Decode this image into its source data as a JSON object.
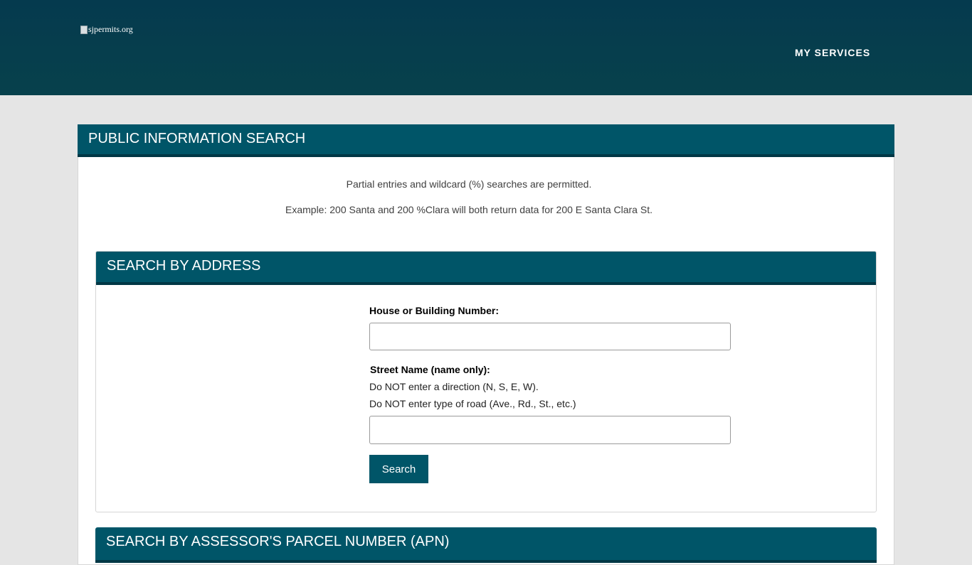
{
  "header": {
    "logo_alt": "sjpermits.org",
    "nav": [
      {
        "label": "MY SERVICES"
      }
    ]
  },
  "public_search": {
    "title": "PUBLIC INFORMATION SEARCH",
    "info": [
      "Partial entries and wildcard (%) searches are permitted.",
      "Example: 200 Santa and 200 %Clara will both return data for 200 E Santa Clara St."
    ]
  },
  "address_search": {
    "title": "SEARCH BY ADDRESS",
    "house_label": "House or Building Number:",
    "house_value": "",
    "street_label": "Street Name (name only):",
    "street_notes": [
      "Do NOT enter a direction (N, S, E, W).",
      "Do NOT enter type of road (Ave., Rd., St., etc.)"
    ],
    "street_value": "",
    "search_label": "Search"
  },
  "apn_search": {
    "title": "SEARCH BY ASSESSOR'S PARCEL NUMBER (APN)"
  },
  "colors": {
    "topbar": "#053a4e",
    "panel_header": "#005568",
    "panel_header_border": "#013745",
    "page_background": "#e5e5e5"
  }
}
